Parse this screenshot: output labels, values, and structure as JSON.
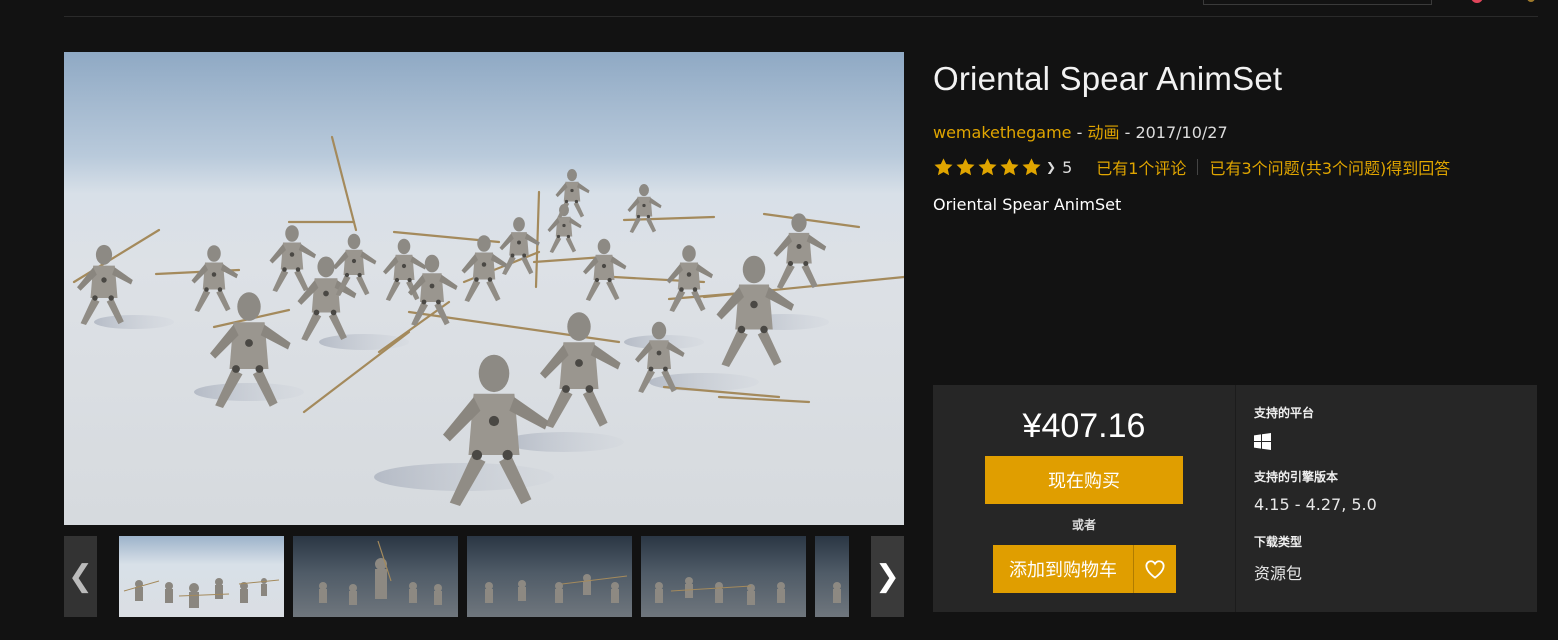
{
  "product": {
    "title": "Oriental Spear AnimSet",
    "author": "wemakethegame",
    "meta_sep1": " - ",
    "category": "动画",
    "meta_sep2": " - ",
    "date": "2017/10/27",
    "rating_count": "5",
    "reviews_link": "已有1个评论",
    "questions_link": "已有3个问题(共3个问题)得到回答",
    "subtitle": "Oriental Spear AnimSet",
    "rating_value_stars": 5
  },
  "purchase": {
    "price": "¥407.16",
    "buy_label": "现在购买",
    "or_label": "或者",
    "cart_label": "添加到购物车"
  },
  "specs": {
    "platform_heading": "支持的平台",
    "platform_icon": "windows-icon",
    "engine_heading": "支持的引擎版本",
    "engine_versions": "4.15 - 4.27, 5.0",
    "download_heading": "下载类型",
    "download_type": "资源包"
  },
  "gallery": {
    "prev_icon": "chevron-left-icon",
    "next_icon": "chevron-right-icon",
    "thumbnail_count_visible": 5
  },
  "colors": {
    "accent": "#e09e00",
    "link": "#e0a500",
    "background": "#121212",
    "panel": "#262626"
  }
}
